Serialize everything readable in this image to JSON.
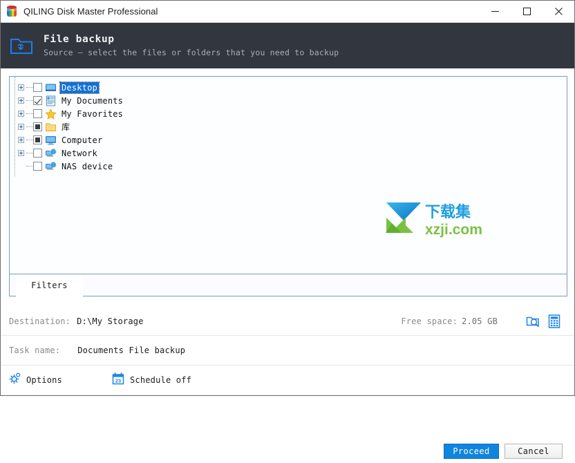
{
  "window": {
    "title": "QILING Disk Master Professional",
    "app_icon": "cube-icon",
    "minimize": "−",
    "maximize": "□",
    "close": "✕"
  },
  "header": {
    "icon": "folder-backup-icon",
    "title": "File backup",
    "subtitle": "Source — select the files or folders that you need to backup",
    "background": "#32363f"
  },
  "tree": {
    "nodes": [
      {
        "label": "Desktop",
        "icon": "desktop-icon",
        "check": "unchecked",
        "expandable": true,
        "selected": true
      },
      {
        "label": "My Documents",
        "icon": "documents-icon",
        "check": "checked",
        "expandable": true,
        "selected": false
      },
      {
        "label": "My Favorites",
        "icon": "star-icon",
        "check": "unchecked",
        "expandable": true,
        "selected": false
      },
      {
        "label": "库",
        "icon": "folder-icon",
        "check": "partial",
        "expandable": true,
        "selected": false
      },
      {
        "label": "Computer",
        "icon": "computer-icon",
        "check": "partial",
        "expandable": true,
        "selected": false
      },
      {
        "label": "Network",
        "icon": "network-icon",
        "check": "unchecked",
        "expandable": true,
        "selected": false
      },
      {
        "label": "NAS device",
        "icon": "nas-device-icon",
        "check": "unchecked",
        "expandable": false,
        "selected": false
      }
    ]
  },
  "watermark": {
    "cn_text": "下载集",
    "url_text": "xzji.com",
    "arrow_color": "#1f9ee0",
    "chevron_color": "#7ac143"
  },
  "filters": {
    "tab_label": "Filters"
  },
  "destination": {
    "label": "Destination:",
    "value": "D:\\My Storage",
    "free_space_label": "Free space:",
    "free_space_value": "2.05 GB",
    "browse_icon": "folder-search-icon",
    "calculator_icon": "calculator-icon"
  },
  "task": {
    "label": "Task name:",
    "value": "Documents File backup"
  },
  "options": {
    "options_label": "Options",
    "options_icon": "gear-icon",
    "schedule_label": "Schedule off",
    "schedule_icon": "calendar-icon",
    "schedule_day": "23"
  },
  "footer": {
    "proceed_label": "Proceed",
    "cancel_label": "Cancel",
    "proceed_color": "#1184dd"
  }
}
